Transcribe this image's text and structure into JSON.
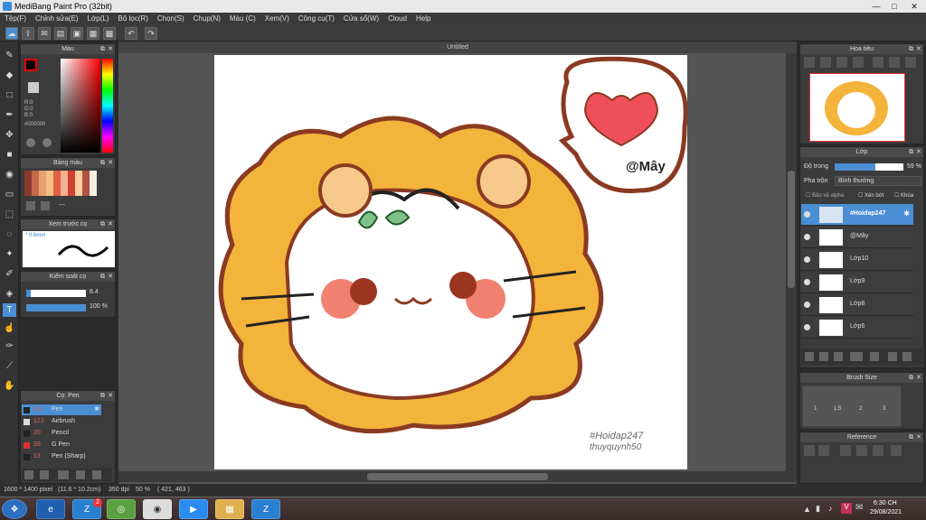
{
  "window": {
    "title": "MediBang Paint Pro (32bit)"
  },
  "menu": [
    "Tệp(F)",
    "Chỉnh sửa(E)",
    "Lớp(L)",
    "Bộ lọc(R)",
    "Chọn(S)",
    "Chụp(N)",
    "Màu (C)",
    "Xem(V)",
    "Công cụ(T)",
    "Cửa sổ(W)",
    "Cloud",
    "Help"
  ],
  "color_panel": {
    "title": "Màu",
    "r": "R:0",
    "g": "G:0",
    "b": "B:0",
    "hex": "#000000"
  },
  "palette_panel": {
    "title": "Bảng màu",
    "dots": "---"
  },
  "brush_preview": {
    "title": "Xem trước cọ",
    "size": "* 0.6mm"
  },
  "brush_control": {
    "title": "Kiểm soát cọ",
    "size": "8.4",
    "opacity": "100 %"
  },
  "brush_list": {
    "title": "Cọ: Pen",
    "items": [
      {
        "size": "8.4",
        "name": "Pen",
        "color": "#222"
      },
      {
        "size": "123",
        "name": "Airbrush",
        "color": "#ddd"
      },
      {
        "size": "20",
        "name": "Pencil",
        "color": "#222"
      },
      {
        "size": "39",
        "name": "G Pen",
        "color": "#e03030"
      },
      {
        "size": "13",
        "name": "Pen (Sharp)",
        "color": "#222"
      }
    ]
  },
  "canvas": {
    "tab": "Untitled",
    "signature": "@Mây",
    "watermark1": "#Hoidap247",
    "watermark2": "thuyquynh50"
  },
  "navigator": {
    "title": "Hoa tiêu"
  },
  "layers": {
    "title": "Lớp",
    "opacity_label": "Độ trong",
    "opacity_value": "59 %",
    "opacity_fraction": 0.59,
    "blend_label": "Pha trộn",
    "blend_value": "Bình thường",
    "protect": "Bảo vệ alpha",
    "clip": "Xén bớt",
    "lock": "Khóa",
    "items": [
      {
        "name": "#Hoidap247",
        "selected": true
      },
      {
        "name": "@Mây"
      },
      {
        "name": "Lớp10"
      },
      {
        "name": "Lớp9"
      },
      {
        "name": "Lớp8"
      },
      {
        "name": "Lớp6"
      }
    ]
  },
  "brush_size": {
    "title": "Brush Size",
    "sizes": [
      "1",
      "1.5",
      "2",
      "3"
    ]
  },
  "reference": {
    "title": "Reference"
  },
  "status": {
    "dims": "1600 * 1400 pixel",
    "cm": "(11.6 * 10.2cm)",
    "dpi": "350 dpi",
    "zoom": "50 %",
    "coords": "( 421, 463 )"
  },
  "clock": {
    "time": "6:30 CH",
    "date": "29/08/2021"
  },
  "taskbar": {
    "badge": "2"
  }
}
